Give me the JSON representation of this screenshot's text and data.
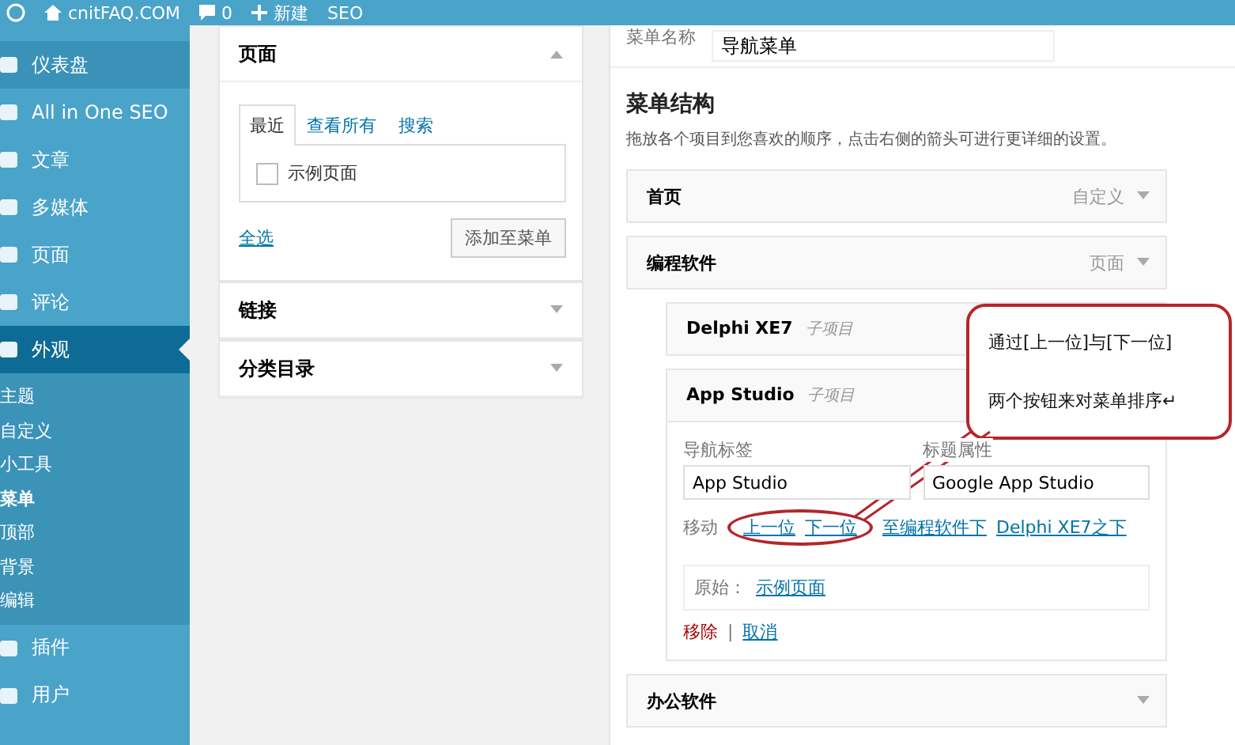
{
  "admin_bar": {
    "site": "cnitFAQ.COM",
    "comments": "0",
    "new": "新建",
    "seo": "SEO"
  },
  "sidebar": {
    "items": [
      {
        "label": "仪表盘",
        "selected": false,
        "hover": true
      },
      {
        "label": "All in One SEO",
        "selected": false,
        "hover": false
      },
      {
        "label": "文章",
        "selected": false,
        "hover": false
      },
      {
        "label": "多媒体",
        "selected": false,
        "hover": false
      },
      {
        "label": "页面",
        "selected": false,
        "hover": false
      },
      {
        "label": "评论",
        "selected": false,
        "hover": false
      },
      {
        "label": "外观",
        "selected": true,
        "hover": false,
        "children": [
          {
            "label": "主题",
            "selected": false
          },
          {
            "label": "自定义",
            "selected": false
          },
          {
            "label": "小工具",
            "selected": false
          },
          {
            "label": "菜单",
            "selected": true
          },
          {
            "label": "顶部",
            "selected": false
          },
          {
            "label": "背景",
            "selected": false
          },
          {
            "label": "编辑",
            "selected": false
          }
        ]
      },
      {
        "label": "插件",
        "selected": false,
        "hover": false
      },
      {
        "label": "用户",
        "selected": false,
        "hover": false
      }
    ]
  },
  "add_panel": {
    "sections": [
      {
        "title": "页面",
        "expanded": true,
        "tabs": [
          {
            "label": "最近",
            "selected": true
          },
          {
            "label": "查看所有",
            "selected": false
          },
          {
            "label": "搜索",
            "selected": false
          }
        ],
        "items": [
          {
            "label": "示例页面",
            "checked": false
          }
        ],
        "select_all": "全选",
        "add_button": "添加至菜单"
      },
      {
        "title": "链接",
        "expanded": false
      },
      {
        "title": "分类目录",
        "expanded": false
      }
    ]
  },
  "menu_editor": {
    "name_label": "菜单名称",
    "name_value": "导航菜单",
    "heading": "菜单结构",
    "description": "拖放各个项目到您喜欢的顺序，点击右侧的箭头可进行更详细的设置。",
    "items": [
      {
        "title": "首页",
        "type": "自定义",
        "expanded": false
      },
      {
        "title": "编程软件",
        "type": "页面",
        "expanded": false,
        "children": [
          {
            "title": "Delphi XE7",
            "subtitle": "子项目",
            "expanded": false
          },
          {
            "title": "App Studio",
            "subtitle": "子项目",
            "expanded": true,
            "nav_label": "导航标签",
            "nav_value": "App Studio",
            "attr_label": "标题属性",
            "attr_value": "Google App Studio",
            "move_label": "移动",
            "move_links": [
              "上一位",
              "下一位",
              "至编程软件下",
              "Delphi XE7之下"
            ],
            "original_label": "原始：",
            "original_link": "示例页面",
            "remove": "移除",
            "separator": "|",
            "cancel": "取消"
          }
        ]
      },
      {
        "title": "办公软件",
        "expanded": false
      }
    ]
  },
  "callout": {
    "lines": [
      "通过[上一位]与[下一位]",
      "两个按钮来对菜单排序↵"
    ]
  }
}
